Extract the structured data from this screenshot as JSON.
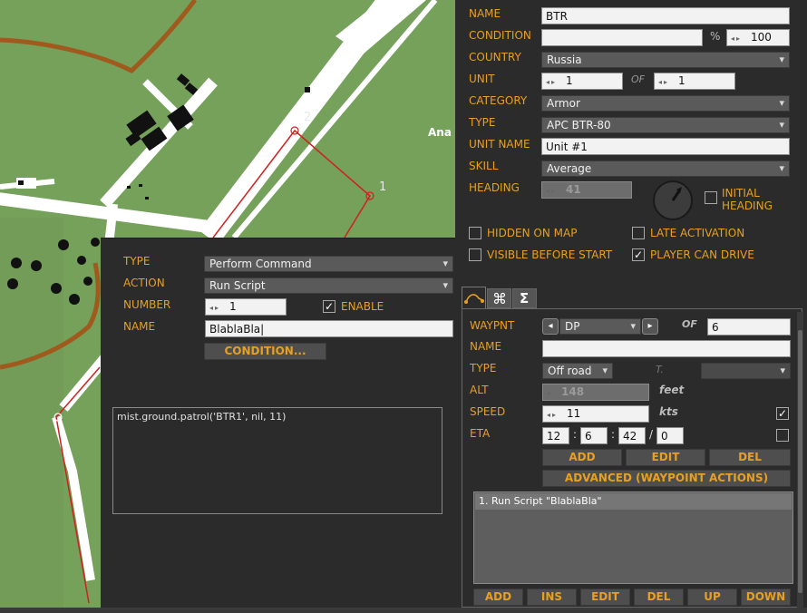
{
  "unit": {
    "name_label": "NAME",
    "name_value": "BTR",
    "condition_label": "CONDITION",
    "condition_value": "",
    "condition_pct": "%",
    "condition_num": "100",
    "country_label": "COUNTRY",
    "country_value": "Russia",
    "unit_label": "UNIT",
    "unit_value": "1",
    "of_label": "OF",
    "of_value": "1",
    "category_label": "CATEGORY",
    "category_value": "Armor",
    "type_label": "TYPE",
    "type_value": "APC BTR-80",
    "unit_name_label": "UNIT NAME",
    "unit_name_value": "Unit #1",
    "skill_label": "SKILL",
    "skill_value": "Average",
    "heading_label": "HEADING",
    "heading_value": "41",
    "initial_heading_label": "INITIAL HEADING",
    "hidden_on_map_label": "HIDDEN ON MAP",
    "late_activation_label": "LATE ACTIVATION",
    "visible_before_start_label": "VISIBLE BEFORE START",
    "player_can_drive_label": "PLAYER CAN DRIVE"
  },
  "tabs": [
    {
      "icon": "route-icon"
    },
    {
      "icon": "command-icon"
    },
    {
      "icon": "sigma-icon"
    }
  ],
  "waypoint": {
    "waypnt_label": "WAYPNT",
    "waypnt_value": "DP",
    "of_label": "OF",
    "of_value": "6",
    "name_label": "NAME",
    "name_value": "",
    "type_label": "TYPE",
    "type_value": "Off road",
    "t_label": "T.",
    "alt_label": "ALT",
    "alt_value": "148",
    "alt_unit": "feet",
    "speed_label": "SPEED",
    "speed_value": "11",
    "speed_unit": "kts",
    "eta_label": "ETA",
    "eta_h": "12",
    "eta_m": "6",
    "eta_s": "42",
    "eta_d": "0",
    "colon": ":",
    "slash": "/",
    "add": "ADD",
    "edit": "EDIT",
    "del": "DEL",
    "advanced": "ADVANCED (WAYPOINT ACTIONS)",
    "actions": [
      "1. Run Script \"BlablaBla\""
    ],
    "bottom": [
      "ADD",
      "INS",
      "EDIT",
      "DEL",
      "UP",
      "DOWN"
    ]
  },
  "action_dialog": {
    "type_label": "TYPE",
    "type_value": "Perform Command",
    "action_label": "ACTION",
    "action_value": "Run Script",
    "number_label": "NUMBER",
    "number_value": "1",
    "enable_label": "ENABLE",
    "name_label": "NAME",
    "name_value": "BlablaBla",
    "condition_button": "CONDITION...",
    "script_text": "mist.ground.patrol('BTR1', nil, 11)"
  },
  "map": {
    "label_partial": "Ana",
    "grid_label_a": "2",
    "grid_label_b": "1",
    "colors": {
      "grass": "#75a15a",
      "road": "#ffffff",
      "river": "#a05a1e",
      "route": "#d02020"
    }
  }
}
